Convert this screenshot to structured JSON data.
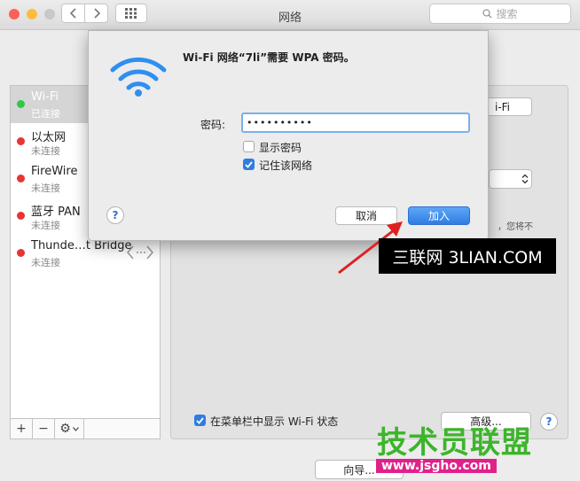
{
  "window": {
    "title": "网络",
    "search_placeholder": "搜索",
    "traffic_lights": {
      "close": "#fc605b",
      "minimize": "#fdbc40",
      "zoom": "#c8c8c8"
    }
  },
  "services": [
    {
      "name": "Wi-Fi",
      "status": "已连接",
      "color": "#2ec94a",
      "selected": true
    },
    {
      "name": "以太网",
      "status": "未连接",
      "color": "#e83434",
      "selected": false
    },
    {
      "name": "FireWire",
      "status": "未连接",
      "color": "#e83434",
      "selected": false
    },
    {
      "name": "蓝牙 PAN",
      "status": "未连接",
      "color": "#e83434",
      "selected": false
    },
    {
      "name": "Thunde…t Bridge",
      "status": "未连接",
      "color": "#e83434",
      "selected": false
    }
  ],
  "sidebar_toolbar": {
    "add": "+",
    "remove": "−",
    "gear": "⚙"
  },
  "main": {
    "wifi_button": "i-Fi",
    "partial_text": "，您将不",
    "show_wifi_status_label": "在菜单栏中显示 Wi-Fi 状态",
    "show_wifi_status_checked": true,
    "advanced_button": "高级...",
    "assistant_button": "向导..."
  },
  "dialog": {
    "title": "Wi-Fi 网络“7li”需要 WPA 密码。",
    "password_label": "密码:",
    "password_value": "••••••••••",
    "show_password_label": "显示密码",
    "show_password_checked": false,
    "remember_network_label": "记住该网络",
    "remember_network_checked": true,
    "help": "?",
    "cancel_button": "取消",
    "join_button": "加入",
    "accent": "#2f7de1"
  },
  "watermarks": {
    "sanlian": "三联网 3LIAN.COM",
    "jsgho_title": "技术员联盟",
    "jsgho_url": "www.jsgho.com"
  }
}
